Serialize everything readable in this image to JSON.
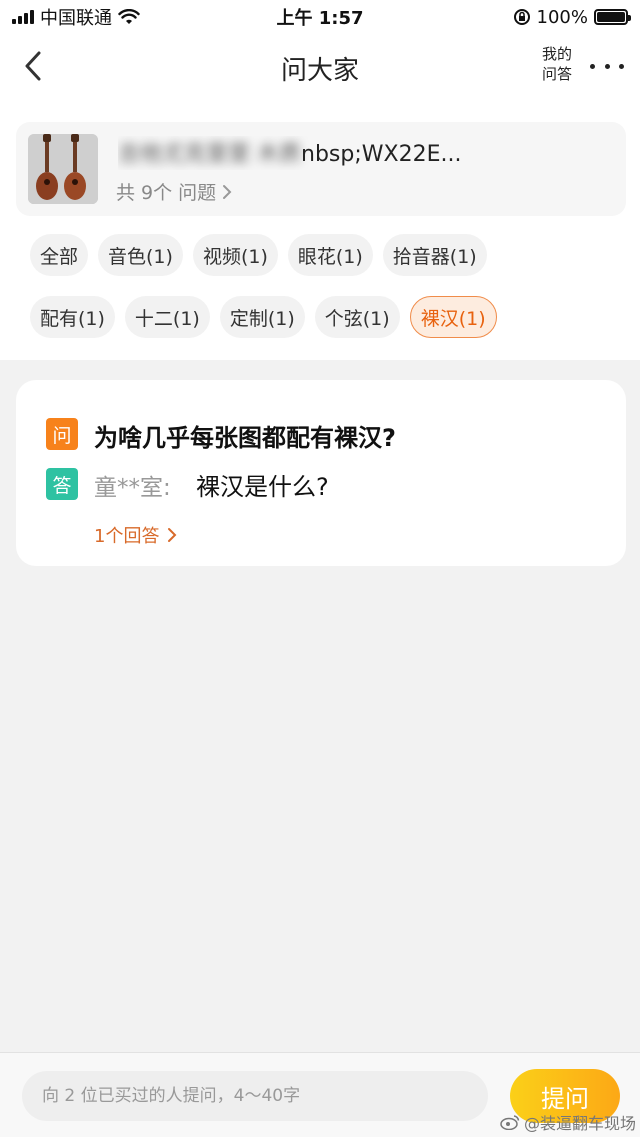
{
  "status_bar": {
    "carrier": "中国联通",
    "time": "上午 1:57",
    "battery": "100%",
    "battery_level": 1.0
  },
  "nav": {
    "title": "问大家",
    "my_qa_line1": "我的",
    "my_qa_line2": "问答"
  },
  "product": {
    "title_blurred": "吉他尤克里里 木质",
    "title_visible": "nbsp;WX22E...",
    "question_count": "共 9个 问题"
  },
  "tags": [
    [
      {
        "label": "全部",
        "active": false
      },
      {
        "label": "音色(1)",
        "active": false
      },
      {
        "label": "视频(1)",
        "active": false
      },
      {
        "label": "眼花(1)",
        "active": false
      },
      {
        "label": "拾音器(1)",
        "active": false
      }
    ],
    [
      {
        "label": "配有(1)",
        "active": false
      },
      {
        "label": "十二(1)",
        "active": false
      },
      {
        "label": "定制(1)",
        "active": false
      },
      {
        "label": "个弦(1)",
        "active": false
      },
      {
        "label": "裸汉(1)",
        "active": true
      }
    ]
  ],
  "qa": {
    "q_badge": "问",
    "question": "为啥几乎每张图都配有裸汉?",
    "a_badge": "答",
    "answer_user": "童**室:",
    "answer": "裸汉是什么?",
    "answer_count": "1个回答"
  },
  "ask": {
    "placeholder": "向 2 位已买过的人提问，4～40字",
    "button": "提问"
  },
  "watermark": "@装逼翻车现场",
  "colors": {
    "accent_orange": "#f7821b",
    "answer_green": "#2ec2a2",
    "ask_button": "#fbb617",
    "active_tag_text": "#e8620f"
  }
}
